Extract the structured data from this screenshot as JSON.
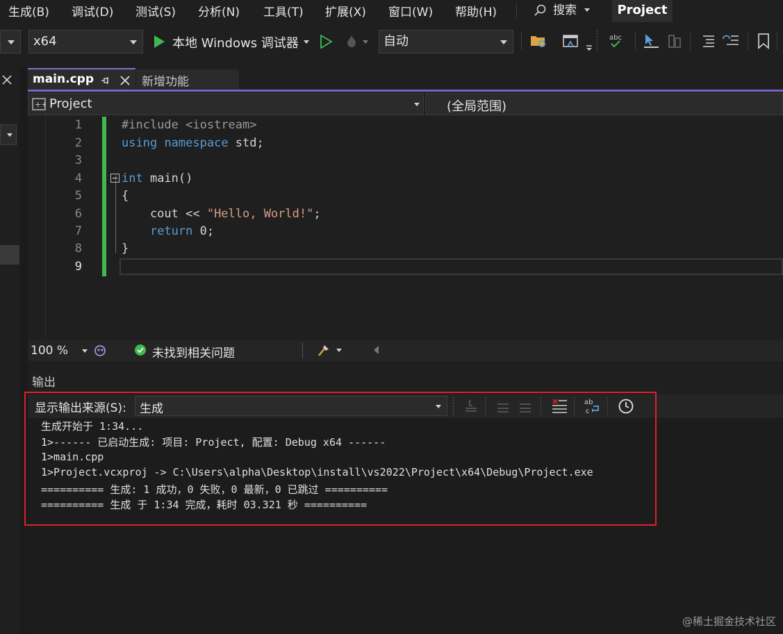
{
  "menu": {
    "items": [
      "生成(B)",
      "调试(D)",
      "测试(S)",
      "分析(N)",
      "工具(T)",
      "扩展(X)",
      "窗口(W)",
      "帮助(H)"
    ],
    "search_label": "搜索",
    "project_title": "Project"
  },
  "toolbar": {
    "platform": "x64",
    "run_label": "本地 Windows 调试器",
    "config": "自动"
  },
  "tabs": [
    {
      "label": "main.cpp"
    },
    {
      "label": "新增功能"
    }
  ],
  "navbar": {
    "scope_project": "Project",
    "scope_global": "(全局范围)"
  },
  "editor": {
    "line_numbers": [
      "1",
      "2",
      "3",
      "4",
      "5",
      "6",
      "7",
      "8",
      "9"
    ]
  },
  "status": {
    "zoom": "100 %",
    "issues": "未找到相关问题"
  },
  "output": {
    "title": "输出",
    "source_label": "显示输出来源(S):",
    "source_value": "生成",
    "lines": [
      "生成开始于 1:34...",
      "1>------ 已启动生成: 项目: Project, 配置: Debug x64 ------",
      "1>main.cpp",
      "1>Project.vcxproj -> C:\\Users\\alpha\\Desktop\\install\\vs2022\\Project\\x64\\Debug\\Project.exe",
      "========== 生成: 1 成功，0 失败，0 最新，0 已跳过 ==========",
      "========== 生成 于 1:34 完成，耗时 03.321 秒 =========="
    ]
  },
  "watermark": "@稀土掘金技术社区",
  "colors": {
    "accent": "#7a62c7",
    "highlight_box": "#e0202a",
    "change_bar": "#3fb950",
    "run_green": "#3fb950"
  }
}
